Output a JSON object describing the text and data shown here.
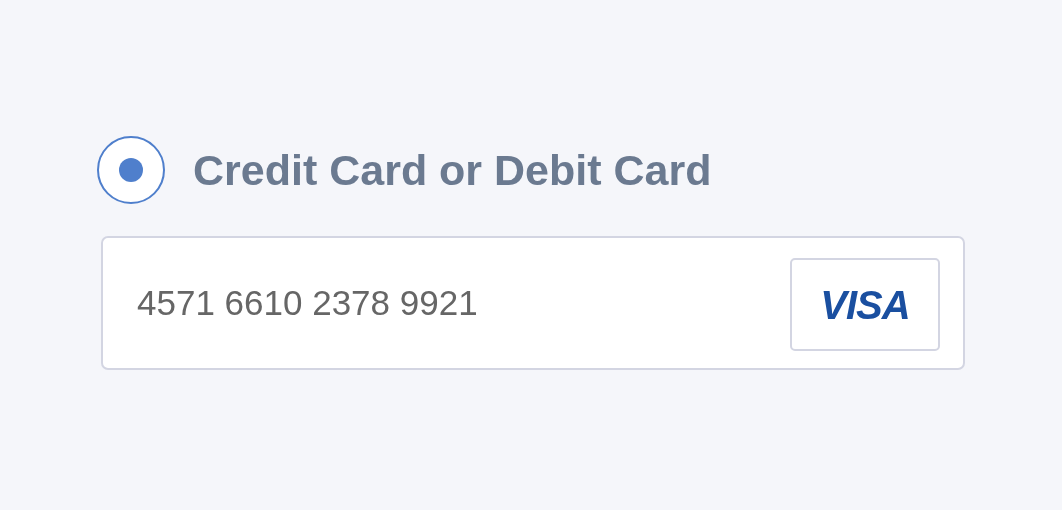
{
  "payment_option": {
    "label": "Credit Card or Debit Card",
    "selected": true
  },
  "card_field": {
    "value": "4571 6610 2378 9921"
  },
  "card_brand": {
    "label": "VISA"
  }
}
